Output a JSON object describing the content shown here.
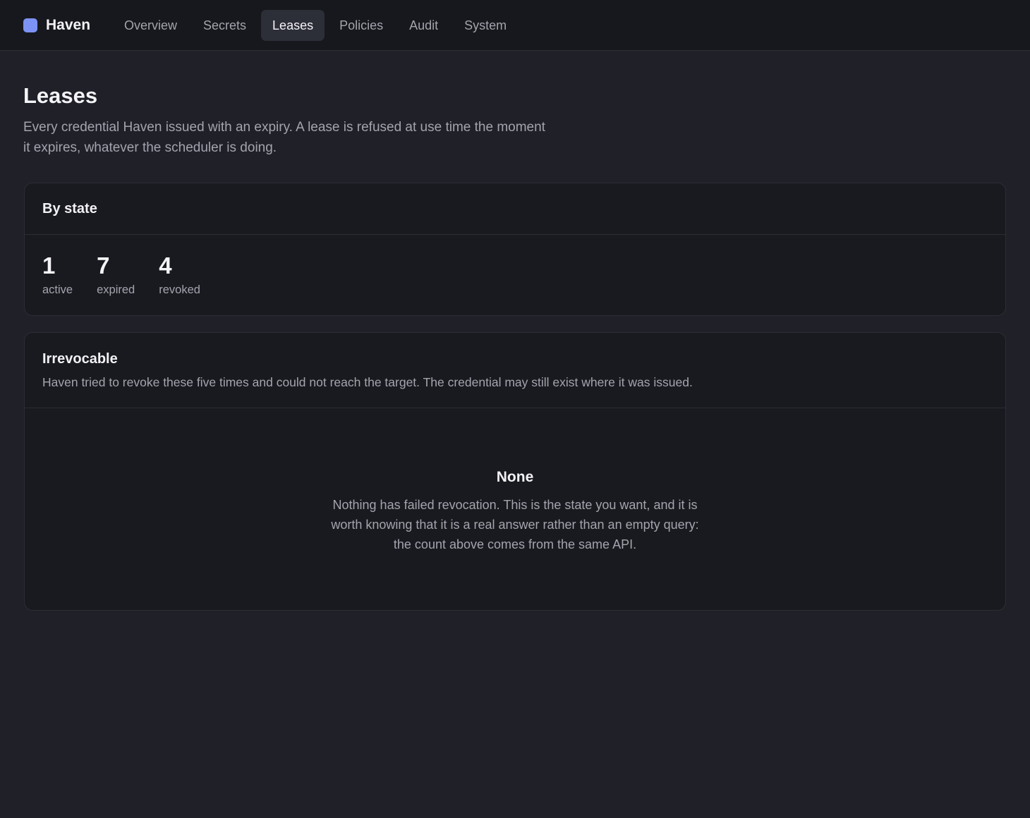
{
  "app": {
    "name": "Haven",
    "accent": "#7c93f5"
  },
  "nav": {
    "tabs": [
      {
        "label": "Overview"
      },
      {
        "label": "Secrets"
      },
      {
        "label": "Leases",
        "active": true
      },
      {
        "label": "Policies"
      },
      {
        "label": "Audit"
      },
      {
        "label": "System"
      }
    ]
  },
  "page": {
    "title": "Leases",
    "description": "Every credential Haven issued with an expiry. A lease is refused at use time the moment it expires, whatever the scheduler is doing."
  },
  "by_state": {
    "title": "By state",
    "stats": [
      {
        "value": "1",
        "label": "active"
      },
      {
        "value": "7",
        "label": "expired"
      },
      {
        "value": "4",
        "label": "revoked"
      }
    ]
  },
  "irrevocable": {
    "title": "Irrevocable",
    "subtitle": "Haven tried to revoke these five times and could not reach the target. The credential may still exist where it was issued.",
    "empty_title": "None",
    "empty_text": "Nothing has failed revocation. This is the state you want, and it is worth knowing that it is a real answer rather than an empty query: the count above comes from the same API."
  }
}
